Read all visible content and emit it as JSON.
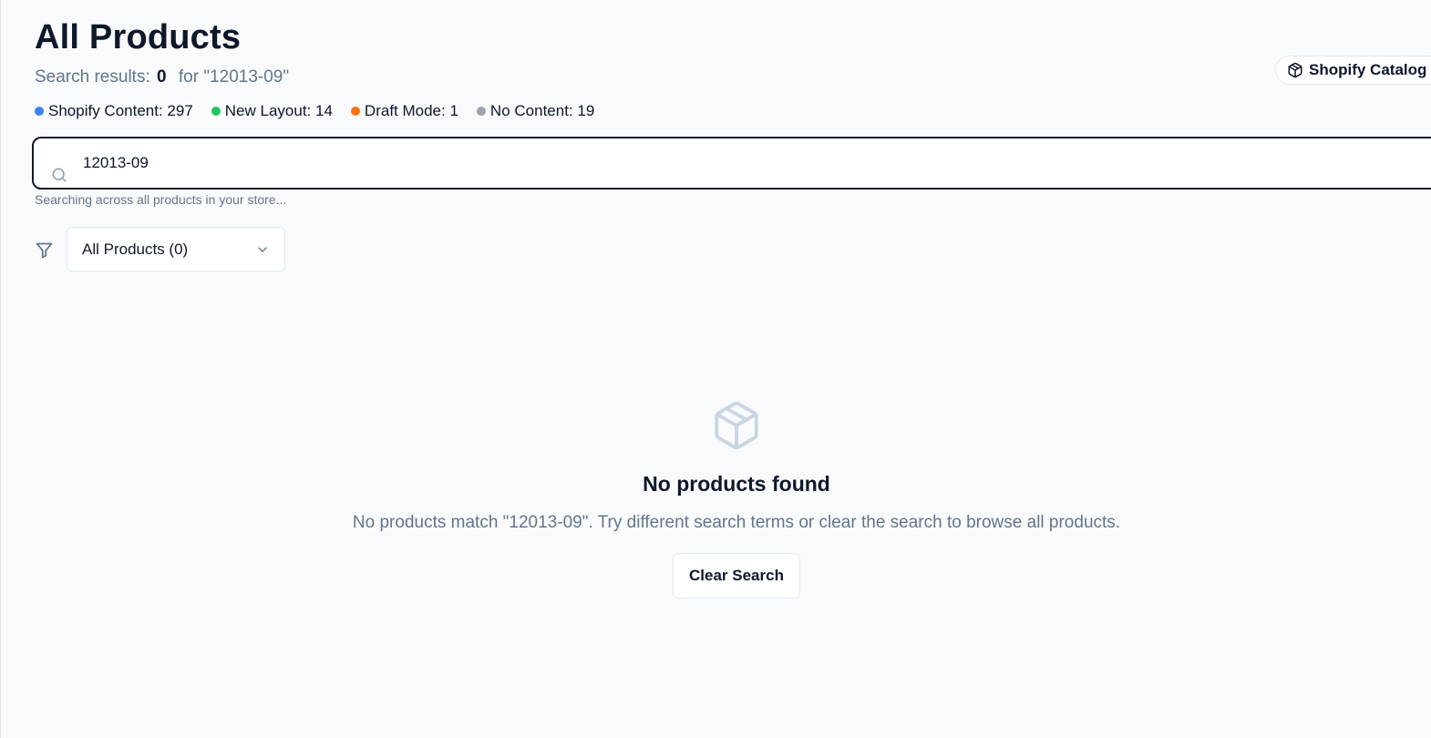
{
  "header": {
    "title": "All Products",
    "results_label": "Search results:",
    "results_count": "0",
    "results_query": "for \"12013-09\""
  },
  "catalog_button": {
    "label": "Shopify Catalog",
    "icon": "package-icon"
  },
  "legend": [
    {
      "label": "Shopify Content: 297",
      "color": "#3b82f6"
    },
    {
      "label": "New Layout: 14",
      "color": "#22c55e"
    },
    {
      "label": "Draft Mode: 1",
      "color": "#f97316"
    },
    {
      "label": "No Content: 19",
      "color": "#9ca3af"
    }
  ],
  "search": {
    "value": "12013-09",
    "icon": "search-icon",
    "helper": "Searching across all products in your store..."
  },
  "filter": {
    "icon": "filter-icon",
    "selected": "All Products (0)",
    "chevron": "chevron-down-icon"
  },
  "empty_state": {
    "icon": "package-icon",
    "title": "No products found",
    "message": "No products match \"12013-09\". Try different search terms or clear the search to browse all products.",
    "button_label": "Clear Search"
  }
}
